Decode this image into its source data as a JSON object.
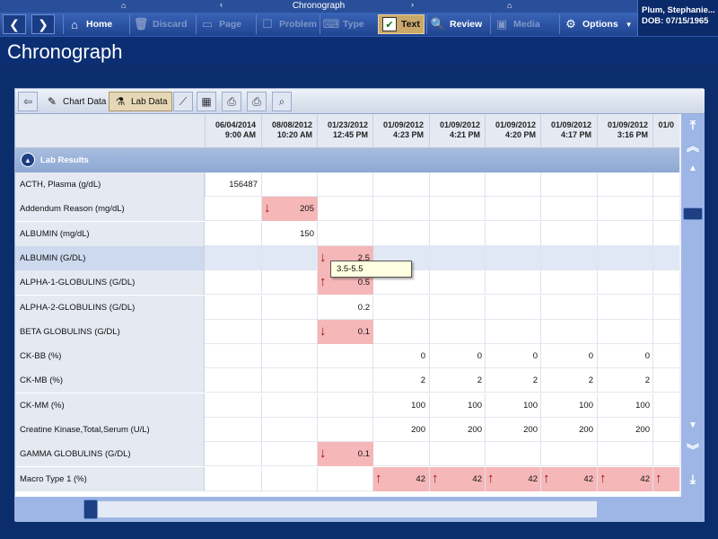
{
  "top": {
    "title": "Chronograph"
  },
  "toolbar": {
    "home": "Home",
    "discard": "Discard",
    "page": "Page",
    "problem": "Problem",
    "type": "Type",
    "text": "Text",
    "review": "Review",
    "media": "Media",
    "options": "Options"
  },
  "patient": {
    "name": "Plum, Stephanie...",
    "dob": "DOB:  07/15/1965"
  },
  "page_title": "Chronograph",
  "subtoolbar": {
    "chart_data": "Chart Data",
    "lab_data": "Lab Data"
  },
  "columns": [
    {
      "date": "06/04/2014",
      "time": "9:00 AM"
    },
    {
      "date": "08/08/2012",
      "time": "10:20 AM"
    },
    {
      "date": "01/23/2012",
      "time": "12:45 PM"
    },
    {
      "date": "01/09/2012",
      "time": "4:23 PM"
    },
    {
      "date": "01/09/2012",
      "time": "4:21 PM"
    },
    {
      "date": "01/09/2012",
      "time": "4:20 PM"
    },
    {
      "date": "01/09/2012",
      "time": "4:17 PM"
    },
    {
      "date": "01/09/2012",
      "time": "3:16 PM"
    },
    {
      "date": "01/0",
      "time": ""
    }
  ],
  "section": "Lab Results",
  "rows": [
    {
      "name": "ACTH, Plasma (g/dL)",
      "cells": [
        {
          "c": 0,
          "v": "156487"
        }
      ]
    },
    {
      "name": "Addendum Reason (mg/dL)",
      "cells": [
        {
          "c": 1,
          "v": "205",
          "flag": "down"
        }
      ]
    },
    {
      "name": "ALBUMIN (mg/dL)",
      "cells": [
        {
          "c": 1,
          "v": "150"
        }
      ]
    },
    {
      "name": "ALBUMIN (G/DL)",
      "cells": [
        {
          "c": 2,
          "v": "2.5",
          "flag": "down"
        }
      ]
    },
    {
      "name": "ALPHA-1-GLOBULINS (G/DL)",
      "cells": [
        {
          "c": 2,
          "v": "0.5",
          "flag": "up"
        }
      ]
    },
    {
      "name": "ALPHA-2-GLOBULINS (G/DL)",
      "cells": [
        {
          "c": 2,
          "v": "0.2"
        }
      ]
    },
    {
      "name": "BETA GLOBULINS (G/DL)",
      "cells": [
        {
          "c": 2,
          "v": "0.1",
          "flag": "down"
        }
      ]
    },
    {
      "name": "CK-BB (%)",
      "cells": [
        {
          "c": 3,
          "v": "0"
        },
        {
          "c": 4,
          "v": "0"
        },
        {
          "c": 5,
          "v": "0"
        },
        {
          "c": 6,
          "v": "0"
        },
        {
          "c": 7,
          "v": "0"
        }
      ]
    },
    {
      "name": "CK-MB (%)",
      "cells": [
        {
          "c": 3,
          "v": "2"
        },
        {
          "c": 4,
          "v": "2"
        },
        {
          "c": 5,
          "v": "2"
        },
        {
          "c": 6,
          "v": "2"
        },
        {
          "c": 7,
          "v": "2"
        }
      ]
    },
    {
      "name": "CK-MM (%)",
      "cells": [
        {
          "c": 3,
          "v": "100"
        },
        {
          "c": 4,
          "v": "100"
        },
        {
          "c": 5,
          "v": "100"
        },
        {
          "c": 6,
          "v": "100"
        },
        {
          "c": 7,
          "v": "100"
        }
      ]
    },
    {
      "name": "Creatine Kinase,Total,Serum (U/L)",
      "cells": [
        {
          "c": 3,
          "v": "200"
        },
        {
          "c": 4,
          "v": "200"
        },
        {
          "c": 5,
          "v": "200"
        },
        {
          "c": 6,
          "v": "200"
        },
        {
          "c": 7,
          "v": "200"
        }
      ]
    },
    {
      "name": "GAMMA GLOBULINS (G/DL)",
      "cells": [
        {
          "c": 2,
          "v": "0.1",
          "flag": "down"
        }
      ]
    },
    {
      "name": "Macro Type 1 (%)",
      "cells": [
        {
          "c": 3,
          "v": "42",
          "flag": "up"
        },
        {
          "c": 4,
          "v": "42",
          "flag": "up"
        },
        {
          "c": 5,
          "v": "42",
          "flag": "up"
        },
        {
          "c": 6,
          "v": "42",
          "flag": "up"
        },
        {
          "c": 7,
          "v": "42",
          "flag": "up"
        },
        {
          "c": 8,
          "v": "",
          "flag": "up"
        }
      ]
    }
  ],
  "tooltip": "3.5-5.5",
  "colors": {
    "abnormal": "#f6b7b9",
    "arrow": "#a01010",
    "accent": "#0c2d6b"
  },
  "icons": [
    "home-icon",
    "discard-icon",
    "page-icon",
    "problem-icon",
    "type-icon",
    "text-check-icon",
    "review-icon",
    "media-icon",
    "options-gear-icon",
    "back-arrow-icon",
    "chart-data-icon",
    "lab-data-icon",
    "graph-icon",
    "calendar-icon",
    "print-icon",
    "print-preview-icon",
    "search-icon"
  ]
}
